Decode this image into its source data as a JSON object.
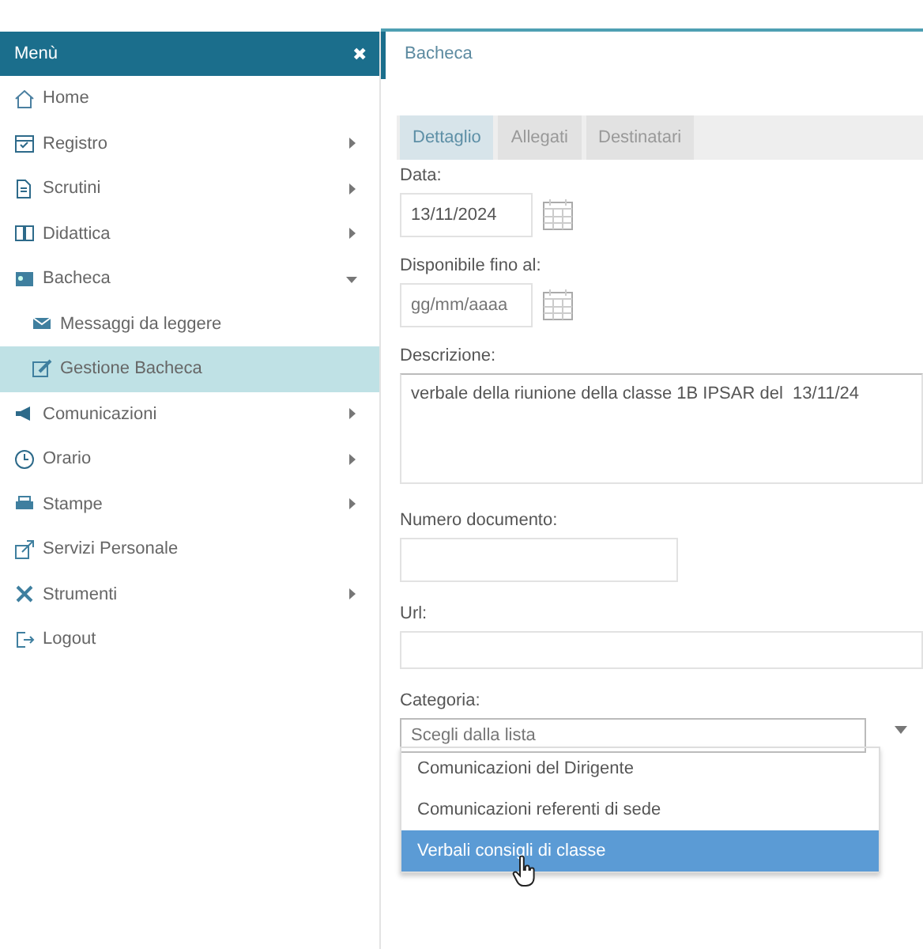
{
  "sidebar": {
    "title": "Menù",
    "close": "✖",
    "items": [
      {
        "label": "Home",
        "kind": "link"
      },
      {
        "label": "Registro",
        "kind": "submenu",
        "expanded": false
      },
      {
        "label": "Scrutini",
        "kind": "submenu",
        "expanded": false
      },
      {
        "label": "Didattica",
        "kind": "submenu",
        "expanded": false
      },
      {
        "label": "Bacheca",
        "kind": "submenu",
        "expanded": true,
        "children": [
          {
            "label": "Messaggi da leggere",
            "selected": false
          },
          {
            "label": "Gestione Bacheca",
            "selected": true
          }
        ]
      },
      {
        "label": "Comunicazioni",
        "kind": "submenu",
        "expanded": false
      },
      {
        "label": "Orario",
        "kind": "submenu",
        "expanded": false
      },
      {
        "label": "Stampe",
        "kind": "submenu",
        "expanded": false
      },
      {
        "label": "Servizi Personale",
        "kind": "link"
      },
      {
        "label": "Strumenti",
        "kind": "submenu",
        "expanded": false
      },
      {
        "label": "Logout",
        "kind": "link"
      }
    ]
  },
  "main": {
    "title": "Bacheca",
    "tabs": [
      {
        "label": "Dettaglio",
        "selected": true
      },
      {
        "label": "Allegati",
        "selected": false
      },
      {
        "label": "Destinatari",
        "selected": false
      }
    ],
    "data": {
      "label": "Data:",
      "value": "13/11/2024"
    },
    "disponibile": {
      "label": "Disponibile fino al:",
      "placeholder": "gg/mm/aaaa"
    },
    "descrizione": {
      "label": "Descrizione:",
      "value": "verbale della riunione della classe 1B IPSAR del  13/11/24"
    },
    "numero": {
      "label": "Numero documento:"
    },
    "url": {
      "label": "Url:"
    },
    "categoria": {
      "label": "Categoria:",
      "placeholder": "Scegli dalla lista",
      "options": [
        {
          "label": "Comunicazioni del Dirigente",
          "selected": false
        },
        {
          "label": "Comunicazioni referenti di sede",
          "selected": false
        },
        {
          "label": "Verbali consigli di classe",
          "selected": true
        }
      ]
    }
  }
}
